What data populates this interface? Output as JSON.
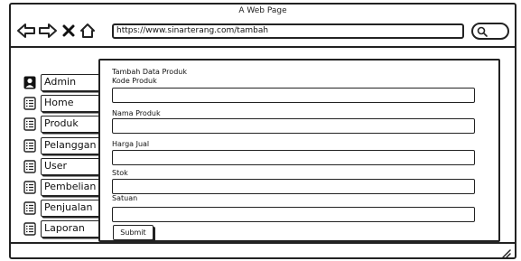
{
  "window": {
    "title": "A Web Page"
  },
  "browser": {
    "url": "https://www.sinarterang.com/tambah",
    "icons": [
      "back-arrow-icon",
      "forward-arrow-icon",
      "close-x-icon",
      "home-icon",
      "search-icon"
    ]
  },
  "sidebar": {
    "items": [
      {
        "label": "Admin",
        "icon": "user-icon"
      },
      {
        "label": "Home",
        "icon": "list-icon"
      },
      {
        "label": "Produk",
        "icon": "list-icon"
      },
      {
        "label": "Pelanggan",
        "icon": "list-icon"
      },
      {
        "label": "User",
        "icon": "list-icon"
      },
      {
        "label": "Pembelian",
        "icon": "list-icon"
      },
      {
        "label": "Penjualan",
        "icon": "list-icon"
      },
      {
        "label": "Laporan",
        "icon": "list-icon"
      }
    ]
  },
  "form": {
    "title": "Tambah Data Produk",
    "fields": [
      {
        "label": "Kode Produk",
        "value": ""
      },
      {
        "label": "Nama Produk",
        "value": ""
      },
      {
        "label": "Harga Jual",
        "value": ""
      },
      {
        "label": "Stok",
        "value": ""
      },
      {
        "label": "Satuan",
        "value": ""
      }
    ],
    "submit_label": "Submit"
  }
}
